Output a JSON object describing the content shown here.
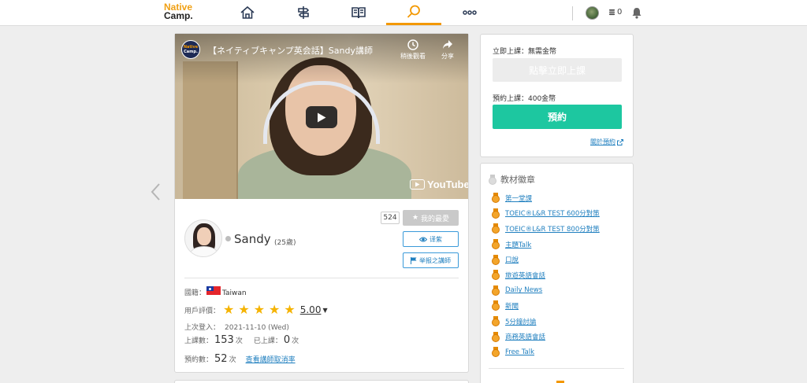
{
  "header": {
    "logo_line1": "Native",
    "logo_line2": "Camp.",
    "nav": [
      {
        "name": "home",
        "icon": "home-icon"
      },
      {
        "name": "signpost",
        "icon": "signpost-icon"
      },
      {
        "name": "textbook",
        "icon": "book-icon"
      },
      {
        "name": "search",
        "icon": "search-icon",
        "active": true
      },
      {
        "name": "more",
        "icon": "more-icon"
      }
    ],
    "coin_count": "0"
  },
  "video": {
    "title": "【ネイティブキャンプ英会話】Sandy講師",
    "channel_logo_line1": "Native",
    "channel_logo_line2": "Camp.",
    "watch_later_label": "稍後觀看",
    "share_label": "分享",
    "youtube_label": "YouTube"
  },
  "teacher": {
    "name": "Sandy",
    "age": "(25歲)",
    "favorite_count": "524",
    "favorite_label": "我的最愛",
    "translate_label": "译紫",
    "report_label": "举报之講師",
    "country_label": "國籍：",
    "country": "Taiwan",
    "rating_label": "用戶評價：",
    "rating": "5.00",
    "rating_stars": 5,
    "last_login_label": "上次登入：",
    "last_login": "2021-11-10 (Wed)",
    "lessons_label": "上課數：",
    "lessons": "153",
    "times_unit": "次",
    "taken_label": "已上課：",
    "taken": "0",
    "bookings_label": "預約數：",
    "bookings": "52",
    "cancel_rate_link": "查看講師取消率"
  },
  "booking": {
    "instant_label": "立即上課：無需金幣",
    "instant_button": "點擊立即上課",
    "reserve_label": "預約上課：400金幣",
    "reserve_button": "預約",
    "about_link": "關於預約"
  },
  "badges": {
    "heading": "教材徽章",
    "items": [
      "第一堂課",
      "TOEIC®L&R TEST 600分對策",
      "TOEIC®L&R TEST 800分對策",
      "主題Talk",
      "口說",
      "旅遊英語會話",
      "Daily News",
      "新聞",
      "5分鐘討論",
      "商務英語會話",
      "Free Talk"
    ]
  },
  "colors": {
    "accent_orange": "#f39800",
    "primary_green": "#1dc7a0",
    "link_blue": "#1f7fbf",
    "star_gold": "#f5b301"
  }
}
